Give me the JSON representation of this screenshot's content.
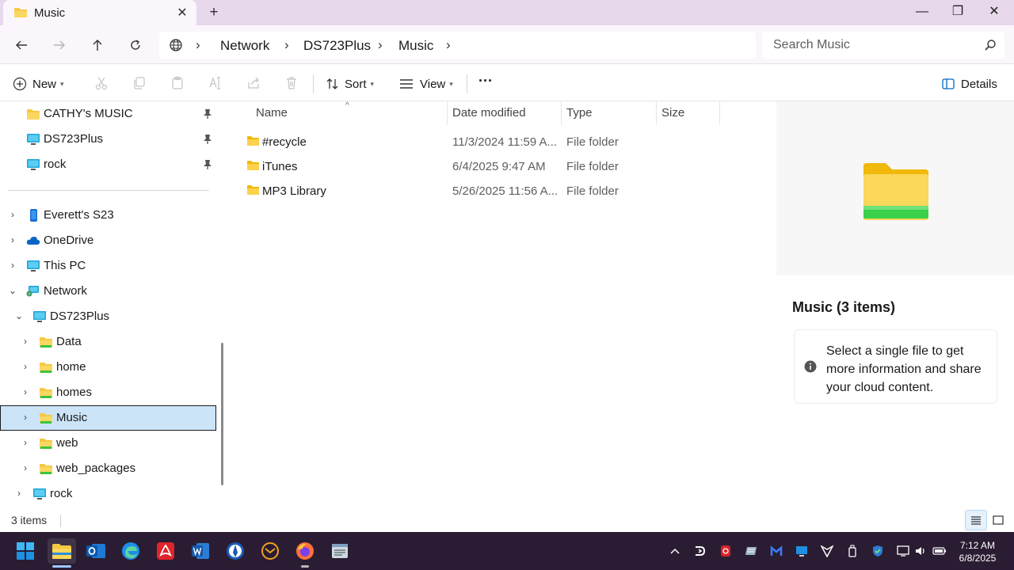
{
  "window": {
    "tab_title": "Music",
    "tab_close": "✕",
    "new_tab": "+",
    "minimize": "—",
    "maximize": "❐",
    "close": "✕"
  },
  "address": {
    "breadcrumbs": [
      "Network",
      "DS723Plus",
      "Music"
    ],
    "search_placeholder": "Search Music"
  },
  "commands": {
    "new": "New",
    "sort": "Sort",
    "view": "View",
    "more": "···",
    "details": "Details"
  },
  "nav": {
    "pinned": [
      {
        "label": "CATHY's MUSIC",
        "icon": "folder-icon"
      },
      {
        "label": "DS723Plus",
        "icon": "monitor-icon"
      },
      {
        "label": "rock",
        "icon": "monitor-icon"
      }
    ],
    "tree": [
      {
        "label": "Everett's S23",
        "icon": "phone-icon",
        "expanded": false
      },
      {
        "label": "OneDrive",
        "icon": "cloud-icon",
        "expanded": false
      },
      {
        "label": "This PC",
        "icon": "monitor-icon",
        "expanded": false
      },
      {
        "label": "Network",
        "icon": "network-icon",
        "expanded": true
      },
      {
        "label": "DS723Plus",
        "icon": "monitor-icon",
        "expanded": true
      },
      {
        "label": "Data",
        "icon": "network-folder-icon",
        "expanded": false
      },
      {
        "label": "home",
        "icon": "network-folder-icon",
        "expanded": false
      },
      {
        "label": "homes",
        "icon": "network-folder-icon",
        "expanded": false
      },
      {
        "label": "Music",
        "icon": "network-folder-icon",
        "expanded": false,
        "selected": true
      },
      {
        "label": "web",
        "icon": "network-folder-icon",
        "expanded": false
      },
      {
        "label": "web_packages",
        "icon": "network-folder-icon",
        "expanded": false
      },
      {
        "label": "rock",
        "icon": "monitor-icon",
        "expanded": false
      }
    ]
  },
  "columns": {
    "name": "Name",
    "date": "Date modified",
    "type": "Type",
    "size": "Size"
  },
  "files": [
    {
      "name": "#recycle",
      "date": "11/3/2024 11:59 A...",
      "type": "File folder",
      "size": ""
    },
    {
      "name": "iTunes",
      "date": "6/4/2025 9:47 AM",
      "type": "File folder",
      "size": ""
    },
    {
      "name": "MP3 Library",
      "date": "5/26/2025 11:56 A...",
      "type": "File folder",
      "size": ""
    }
  ],
  "details_pane": {
    "title": "Music (3 items)",
    "info": "Select a single file to get more information and share your cloud content."
  },
  "status": {
    "count": "3 items"
  },
  "taskbar": {
    "apps": [
      "start-icon",
      "file-explorer-icon",
      "outlook-icon",
      "edge-icon",
      "acrobat-icon",
      "word-icon",
      "app-pen-icon",
      "mail-icon",
      "firefox-icon",
      "notepad-icon"
    ]
  },
  "clock": {
    "time": "7:12 AM",
    "date": "6/8/2025"
  },
  "colors": {
    "titlebar": "#e8d8ec",
    "selection": "#cce4f7",
    "taskbar": "#2a1d33",
    "folder": "#f5c842",
    "accent": "#0067c0"
  }
}
